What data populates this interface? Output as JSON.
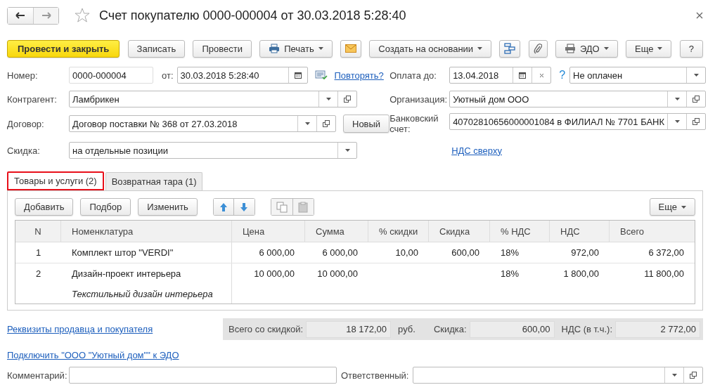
{
  "nav": [
    {
      "kind": "back",
      "disabled": false
    },
    {
      "kind": "forward",
      "disabled": true
    }
  ],
  "title": "Счет покупателю 0000-000004 от 30.03.2018 5:28:40",
  "toolbar": [
    {
      "kind": "primary",
      "label": "Провести и закрыть"
    },
    {
      "kind": "button",
      "label": "Записать"
    },
    {
      "kind": "button",
      "label": "Провести"
    },
    {
      "kind": "print",
      "label": "Печать"
    },
    {
      "kind": "mail"
    },
    {
      "kind": "menu",
      "label": "Создать на основании"
    },
    {
      "kind": "structure"
    },
    {
      "kind": "attach"
    },
    {
      "kind": "edo",
      "label": "ЭДО"
    },
    {
      "kind": "menu",
      "label": "Еще"
    },
    {
      "kind": "button",
      "label": "?"
    }
  ],
  "number": {
    "label": "Номер:",
    "value": "0000-000004"
  },
  "date": {
    "label": "от:",
    "value": "30.03.2018  5:28:40"
  },
  "repeat_link": "Повторять?",
  "counterparty": {
    "label": "Контрагент:",
    "value": "Ламбрикен"
  },
  "contract": {
    "label": "Договор:",
    "value": "Договор поставки № 368 от 27.03.2018",
    "button": "Новый"
  },
  "discount": {
    "label": "Скидка:",
    "value": "на отдельные позиции"
  },
  "pay_until": {
    "label": "Оплата до:",
    "value": "13.04.2018",
    "help": "?",
    "status": "Не оплачен"
  },
  "organization": {
    "label": "Организация:",
    "value": "Уютный дом ООО"
  },
  "bank_account": {
    "label": "Банковский счет:",
    "value": "40702810656000001084 в ФИЛИАЛ № 7701 БАНК"
  },
  "vat_link": "НДС сверху",
  "tabs": [
    {
      "label": "Товары и услуги (2)",
      "selected": true
    },
    {
      "label": "Возвратная тара (1)",
      "selected": false
    }
  ],
  "table_toolbar": [
    {
      "kind": "button",
      "label": "Добавить",
      "disabled": false
    },
    {
      "kind": "button",
      "label": "Подбор",
      "disabled": false
    },
    {
      "kind": "button",
      "label": "Изменить",
      "disabled": false
    },
    {
      "kind": "up",
      "disabled": false
    },
    {
      "kind": "down",
      "disabled": false
    },
    {
      "kind": "copy",
      "disabled": true
    },
    {
      "kind": "paste",
      "disabled": true
    },
    {
      "kind": "menu",
      "label": "Еще",
      "disabled": false
    }
  ],
  "table": {
    "columns": [
      "N",
      "Номенклатура",
      "Цена",
      "Сумма",
      "% скидки",
      "Скидка",
      "% НДС",
      "НДС",
      "Всего"
    ],
    "rows": [
      {
        "cells": [
          "1",
          "Комплект штор \"VERDI\"",
          "6 000,00",
          "6 000,00",
          "10,00",
          "600,00",
          "18%",
          "972,00",
          "6 372,00"
        ]
      },
      {
        "cells": [
          "2",
          "Дизайн-проект интерьера",
          "10 000,00",
          "10 000,00",
          null,
          null,
          "18%",
          "1 800,00",
          "11 800,00"
        ],
        "note": "Текстильный дизайн интерьера"
      }
    ]
  },
  "seller_link": "Реквизиты продавца и покупателя",
  "totals": [
    {
      "label": "Всего со скидкой:",
      "value": "18 172,00",
      "unit": "руб."
    },
    {
      "label": "Скидка:",
      "value": "600,00"
    },
    {
      "label": "НДС (в т.ч.):",
      "value": "2 772,00"
    }
  ],
  "edo_link": "Подключить \"ООО \"Уютный дом\"\" к ЭДО",
  "comment": {
    "label": "Комментарий:"
  },
  "responsible": {
    "label": "Ответственный:"
  }
}
